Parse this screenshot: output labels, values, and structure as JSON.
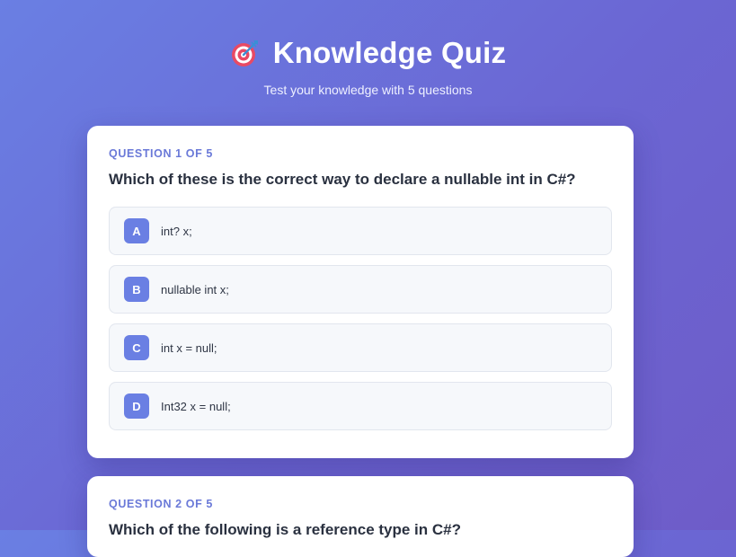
{
  "header": {
    "icon": "target-dart-icon",
    "title": "Knowledge Quiz",
    "subtitle": "Test your knowledge with 5 questions"
  },
  "questions": [
    {
      "counter": "QUESTION 1 OF 5",
      "text": "Which of these is the correct way to declare a nullable int in C#?",
      "options": [
        {
          "letter": "A",
          "text": "int? x;"
        },
        {
          "letter": "B",
          "text": "nullable int x;"
        },
        {
          "letter": "C",
          "text": "int x = null;"
        },
        {
          "letter": "D",
          "text": "Int32 x = null;"
        }
      ]
    },
    {
      "counter": "QUESTION 2 OF 5",
      "text": "Which of the following is a reference type in C#?"
    }
  ],
  "colors": {
    "accent": "#6a7fe3",
    "background_start": "#6a7fe3",
    "background_end": "#6e5cc8"
  }
}
